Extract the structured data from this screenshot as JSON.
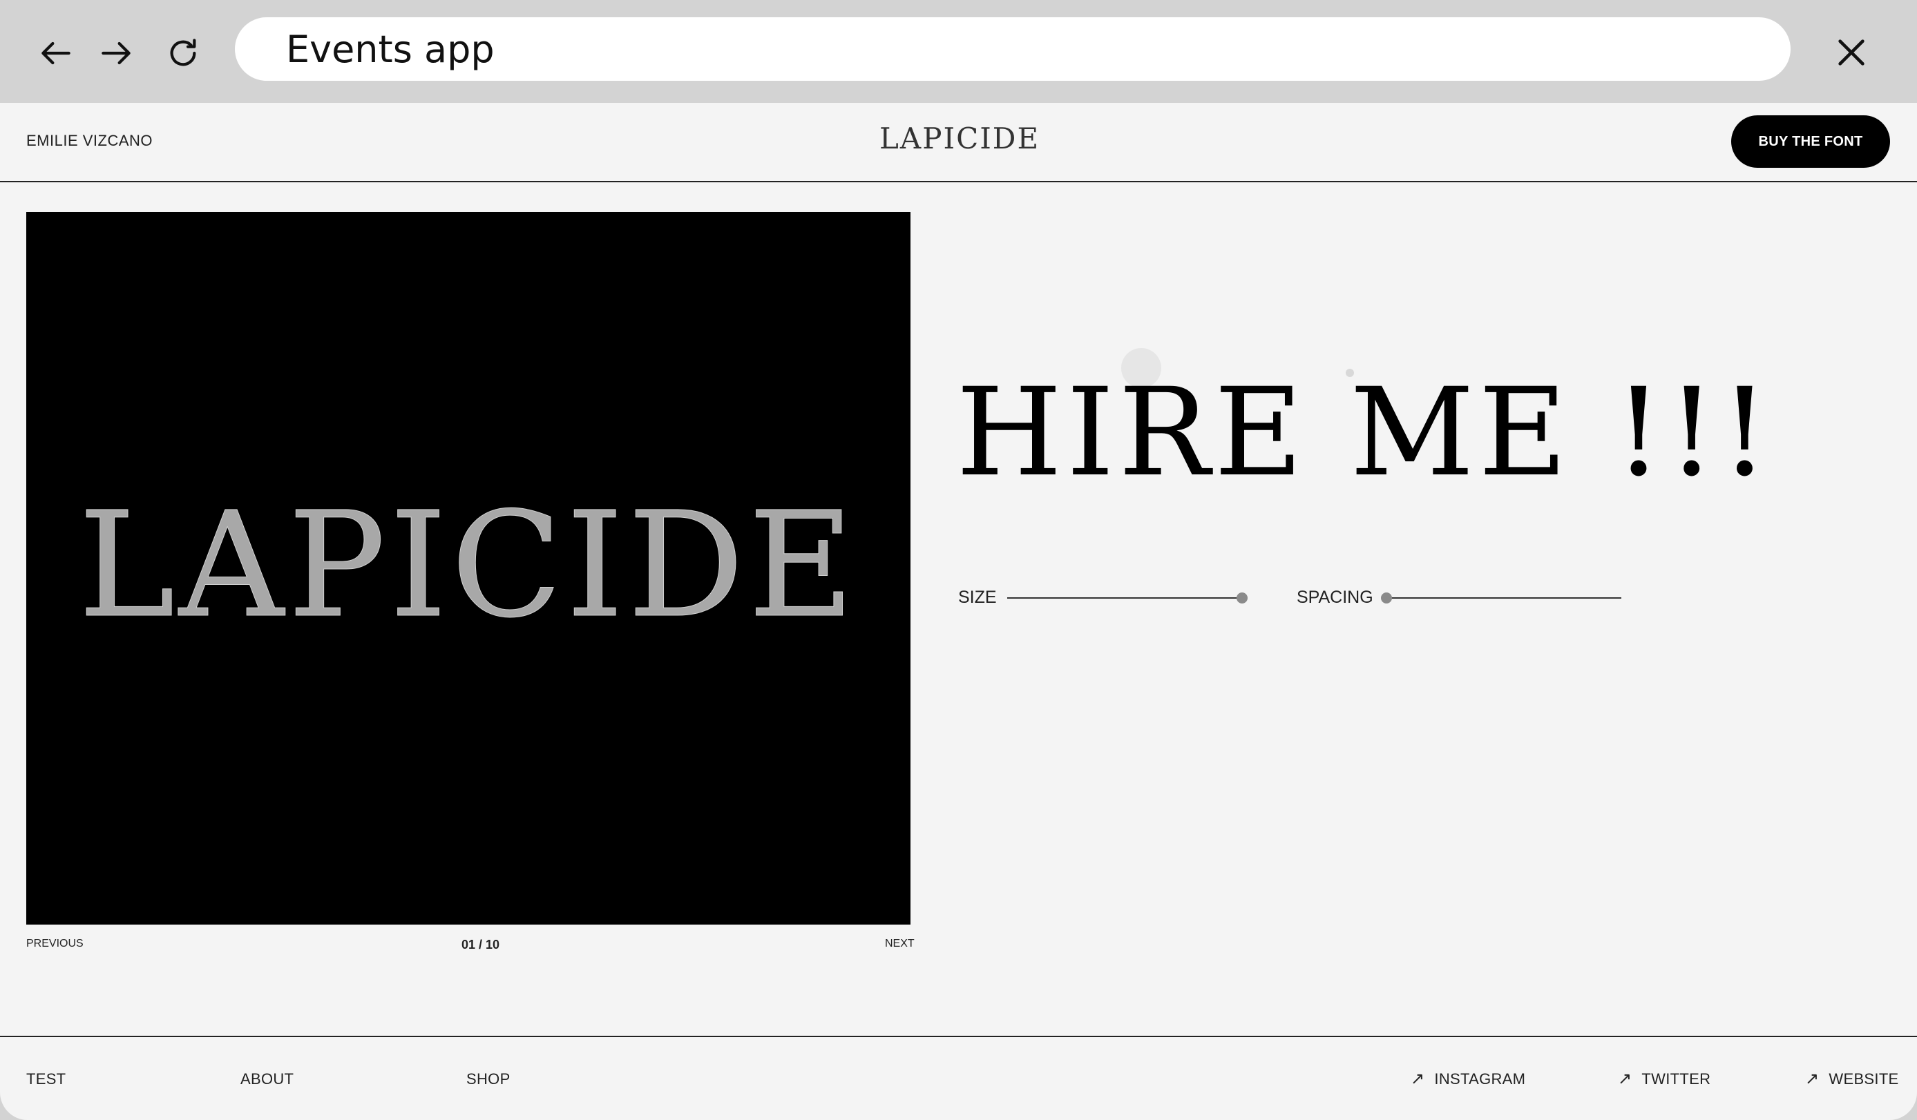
{
  "browser": {
    "address_bar_text": "Events app",
    "icons": {
      "back": "arrow-left-icon",
      "forward": "arrow-right-icon",
      "reload": "reload-icon",
      "close": "close-icon"
    }
  },
  "header": {
    "author": "EMILIE VIZCANO",
    "brand": "LAPICIDE",
    "buy_label": "BUY THE FONT"
  },
  "preview": {
    "word": "LAPICIDE",
    "previous_label": "PREVIOUS",
    "counter": "01 / 10",
    "next_label": "NEXT"
  },
  "tester": {
    "sample_text": "HIRE ME !!!",
    "size_label": "SIZE",
    "size_level": 1.0,
    "spacing_label": "SPACING",
    "spacing_level": 0.0
  },
  "footer": {
    "left_links": [
      "TEST",
      "ABOUT",
      "SHOP"
    ],
    "right_links": [
      {
        "icon": "arrow-up-right-icon",
        "label": "INSTAGRAM"
      },
      {
        "icon": "arrow-up-right-icon",
        "label": "TWITTER"
      },
      {
        "icon": "arrow-up-right-icon",
        "label": "WEBSITE"
      }
    ]
  },
  "colors": {
    "browser_chrome": "#d3d3d3",
    "page_background": "#f4f4f4",
    "preview_background": "#000000",
    "preview_text": "#a8a8a8",
    "button_background": "#000000",
    "slider_thumb": "#8a8a8a"
  }
}
